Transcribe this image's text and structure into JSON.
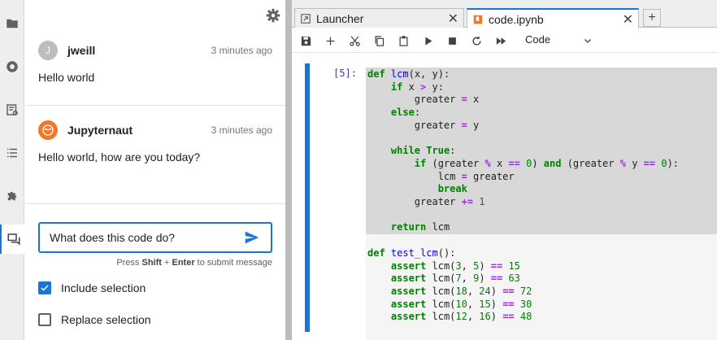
{
  "activity_bar": {
    "items": [
      "folder-icon",
      "running-icon",
      "commands-icon",
      "toc-icon",
      "extensions-icon",
      "chat-icon"
    ]
  },
  "chat": {
    "messages": [
      {
        "initial": "J",
        "author": "jweill",
        "time": "3 minutes ago",
        "text": "Hello world"
      },
      {
        "author": "Jupyternaut",
        "time": "3 minutes ago",
        "text": "Hello world, how are you today?"
      }
    ],
    "input_value": "What does this code do?",
    "hint_prefix": "Press ",
    "hint_shift": "Shift",
    "hint_plus": " + ",
    "hint_enter": "Enter",
    "hint_suffix": " to submit message",
    "include_selection_label": "Include selection",
    "include_selection_checked": true,
    "replace_selection_label": "Replace selection",
    "replace_selection_checked": false
  },
  "tabs": [
    {
      "label": "Launcher",
      "active": false
    },
    {
      "label": "code.ipynb",
      "active": true
    }
  ],
  "toolbar": {
    "cell_type": "Code",
    "icons": [
      "save-icon",
      "add-icon",
      "cut-icon",
      "copy-icon",
      "paste-icon",
      "run-icon",
      "stop-icon",
      "restart-icon",
      "fast-forward-icon"
    ]
  },
  "cell": {
    "prompt": "[5]:",
    "selected_code": [
      "def lcm(x, y):",
      "    if x > y:",
      "        greater = x",
      "    else:",
      "        greater = y",
      "",
      "    while True:",
      "        if (greater % x == 0) and (greater % y == 0):",
      "            lcm = greater",
      "            break",
      "        greater += 1",
      "",
      "    return lcm"
    ],
    "rest_code": [
      "",
      "def test_lcm():",
      "    assert lcm(3, 5) == 15",
      "    assert lcm(7, 9) == 63",
      "    assert lcm(18, 24) == 72",
      "    assert lcm(10, 15) == 30",
      "    assert lcm(12, 16) == 48"
    ]
  },
  "colors": {
    "accent": "#1976d2",
    "jupyter_orange": "#f37726"
  }
}
